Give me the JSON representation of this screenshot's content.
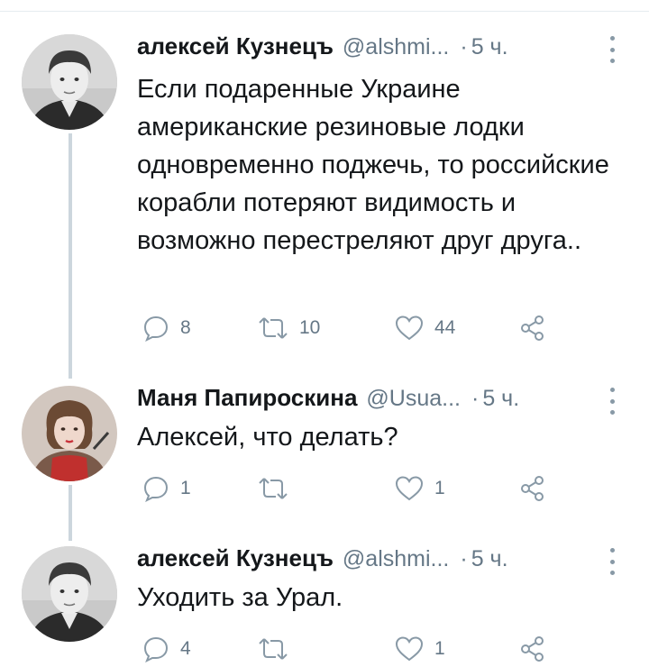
{
  "tweets": [
    {
      "name": "алексей Кузнецъ",
      "handle": "@alshmi...",
      "separator": "·",
      "time": "5 ч.",
      "text": "Если подаренные Украине американские резиновые лодки одновременно поджечь, то российские корабли потеряют видимость и возможно перестреляют друг друга..",
      "avatar_icon": "boy-portrait-avatar",
      "counts": {
        "replies": "8",
        "retweets": "10",
        "likes": "44"
      }
    },
    {
      "name": "Маня Папироскина",
      "handle": "@Usua...",
      "separator": "·",
      "time": "5 ч.",
      "text": "Алексей, что делать?",
      "avatar_icon": "girl-portrait-avatar",
      "counts": {
        "replies": "1",
        "retweets": "",
        "likes": "1"
      }
    },
    {
      "name": "алексей Кузнецъ",
      "handle": "@alshmi...",
      "separator": "·",
      "time": "5 ч.",
      "text": "Уходить за Урал.",
      "avatar_icon": "boy-portrait-avatar",
      "counts": {
        "replies": "4",
        "retweets": "",
        "likes": "1"
      }
    }
  ],
  "icons": {
    "reply": "reply-icon",
    "retweet": "retweet-icon",
    "like": "heart-icon",
    "share": "share-icon",
    "more": "more-vertical-icon"
  },
  "colors": {
    "text": "#14171a",
    "muted": "#657786",
    "icon": "#8899a6",
    "thread_line": "#ccd6dd"
  }
}
